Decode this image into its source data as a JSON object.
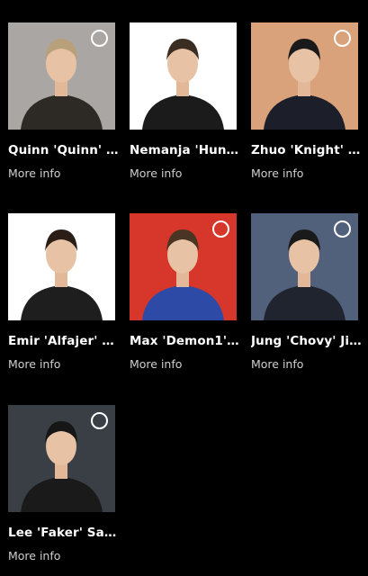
{
  "players": [
    {
      "name": "Quinn 'Quinn' C...",
      "more": "More info",
      "bg": "#a9a6a4",
      "shirt": "#2d2a26",
      "hair": "#b8a07a"
    },
    {
      "name": "Nemanja 'Hunt...",
      "more": "More info",
      "bg": "#ffffff",
      "shirt": "#1b1b1b",
      "hair": "#3b2d22"
    },
    {
      "name": "Zhuo 'Knight' D...",
      "more": "More info",
      "bg": "#d9a27a",
      "shirt": "#1c1f2a",
      "hair": "#1a1a1a"
    },
    {
      "name": "Emir 'Alfajer' Be...",
      "more": "More info",
      "bg": "#ffffff",
      "shirt": "#1e1e1e",
      "hair": "#2a1e17"
    },
    {
      "name": "Max 'Demon1' ...",
      "more": "More info",
      "bg": "#d7362a",
      "shirt": "#2d4aa6",
      "hair": "#4a3424"
    },
    {
      "name": "Jung 'Chovy' Ji-...",
      "more": "More info",
      "bg": "#51607b",
      "shirt": "#20242e",
      "hair": "#1a1a1a"
    },
    {
      "name": "Lee 'Faker' San...",
      "more": "More info",
      "bg": "#3a3f46",
      "shirt": "#1a1a1a",
      "hair": "#161616"
    }
  ]
}
